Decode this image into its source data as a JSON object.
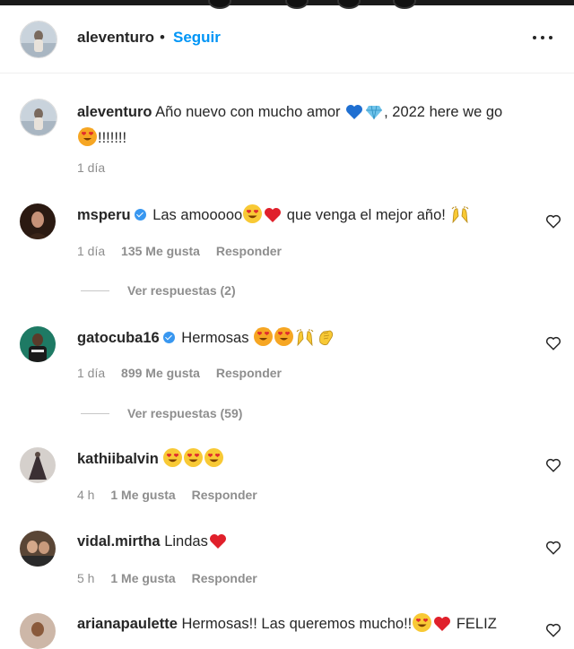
{
  "post": {
    "author": "aleventuro",
    "separator": "•",
    "follow_label": "Seguir"
  },
  "caption": {
    "username": "aleventuro",
    "text_a": "Año nuevo con mucho amor",
    "text_b": ", 2022 here we go",
    "text_c": "!!!!!!!",
    "time": "1 día"
  },
  "comments": [
    {
      "username": "msperu",
      "verified": true,
      "text_a": "Las amooooo",
      "text_b": "que venga el mejor año!",
      "time": "1 día",
      "likes": "135 Me gusta",
      "reply_label": "Responder",
      "view_replies": "Ver respuestas (2)"
    },
    {
      "username": "gatocuba16",
      "verified": true,
      "text_a": "Hermosas",
      "time": "1 día",
      "likes": "899 Me gusta",
      "reply_label": "Responder",
      "view_replies": "Ver respuestas (59)"
    },
    {
      "username": "kathiibalvin",
      "verified": false,
      "text_a": "",
      "time": "4 h",
      "likes": "1 Me gusta",
      "reply_label": "Responder"
    },
    {
      "username": "vidal.mirtha",
      "verified": false,
      "text_a": "Lindas",
      "time": "5 h",
      "likes": "1 Me gusta",
      "reply_label": "Responder"
    },
    {
      "username": "arianapaulette",
      "verified": false,
      "text_a": "Hermosas!! Las queremos mucho!!",
      "text_b": "FELIZ"
    }
  ],
  "icons": [
    "more-options-icon",
    "verified-badge-icon",
    "heart-icon",
    "blue-heart-emoji",
    "gem-emoji",
    "heart-eyes-cat-emoji",
    "heart-eyes-emoji",
    "red-heart-emoji",
    "raising-hands-emoji",
    "clapping-hands-emoji"
  ],
  "colors": {
    "accent": "#0095f6",
    "verified": "#3897f0",
    "muted": "#8e8e8e",
    "text": "#262626"
  }
}
